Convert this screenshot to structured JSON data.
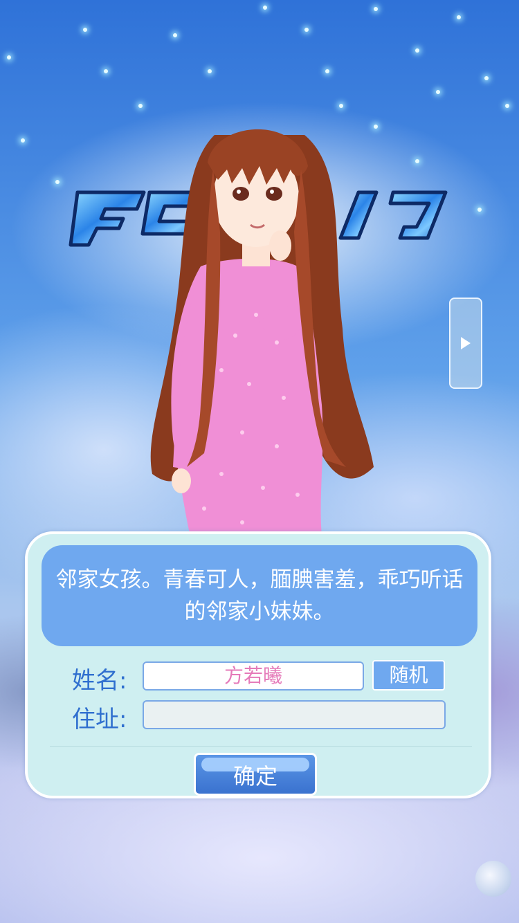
{
  "character": {
    "description": "邻家女孩。青春可人，腼腆害羞，乖巧听话的邻家小妹妹。"
  },
  "form": {
    "name_label": "姓名:",
    "name_value": "方若曦",
    "random_label": "随机",
    "address_label": "住址:",
    "address_value": ""
  },
  "confirm_label": "确定",
  "icons": {
    "next": "play-arrow-icon",
    "logo": "game-logo",
    "orb": "floating-orb-icon"
  },
  "colors": {
    "panel_bg": "#cfeff1",
    "description_bg": "#6fa8ef",
    "label_text": "#2f6fcf",
    "name_text": "#e57ab9",
    "button_blue": "#3a72cf"
  }
}
